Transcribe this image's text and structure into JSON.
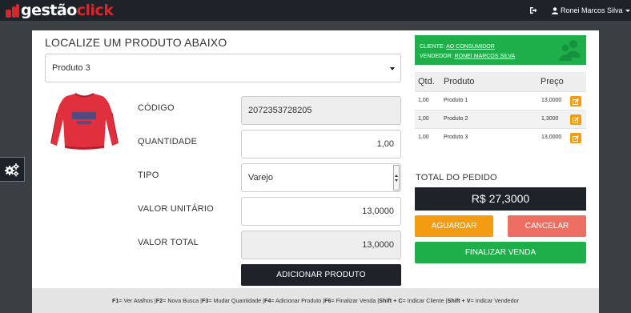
{
  "header": {
    "logo_left": "gestão",
    "logo_right": "click",
    "user_name": "Ronei Marcos Silva",
    "icons": {
      "logo": "logo-mark-icon",
      "exit": "sign-out-icon",
      "user": "user-icon",
      "menu": "caret-down-icon"
    }
  },
  "sidebar": {
    "settings_icon": "gears-icon"
  },
  "search": {
    "title": "LOCALIZE UM PRODUTO ABAIXO",
    "selected_product": "Produto 3"
  },
  "product_form": {
    "code_label": "CÓDIGO",
    "code_value": "2072353728205",
    "qty_label": "QUANTIDADE",
    "qty_value": "1,00",
    "type_label": "TIPO",
    "type_value": "Varejo",
    "unit_price_label": "VALOR UNITÁRIO",
    "unit_price_value": "13,0000",
    "total_label": "VALOR TOTAL",
    "total_value": "13,0000",
    "add_button": "ADICIONAR PRODUTO",
    "image_icon": "product-shirt-image"
  },
  "client": {
    "client_label": "CLIENTE:",
    "client_value": "AO CONSUMIDOR",
    "seller_label": "VENDEDOR:",
    "seller_value": "RONEI MARCOS SILVA",
    "icon": "users-icon"
  },
  "items_table": {
    "headers": {
      "qty": "Qtd.",
      "product": "Produto",
      "price": "Preço"
    },
    "rows": [
      {
        "qty": "1,00",
        "product": "Produto 1",
        "price": "13,0000"
      },
      {
        "qty": "1,00",
        "product": "Produto 2",
        "price": "1,3000"
      },
      {
        "qty": "1,00",
        "product": "Produto 3",
        "price": "13,0000"
      }
    ],
    "edit_icon": "edit-icon"
  },
  "order": {
    "total_title": "TOTAL DO PEDIDO",
    "total_value": "R$ 27,3000",
    "wait_button": "AGUARDAR",
    "cancel_button": "CANCELAR",
    "finish_button": "FINALIZAR VENDA"
  },
  "shortcuts": {
    "f1": "F1",
    "f1_text": " = Ver Atalhos | ",
    "f2": "F2",
    "f2_text": " = Nova Busca | ",
    "f3": "F3",
    "f3_text": " = Mudar Quantidade | ",
    "f4": "F4",
    "f4_text": " = Adicionar Produto | ",
    "f6": "F6",
    "f6_text": " = Finalizar Venda | ",
    "sc": "Shift + C",
    "sc_text": " = Indicar Cliente | ",
    "sv": "Shift + V",
    "sv_text": " = Indicar Vendedor"
  },
  "colors": {
    "dark": "#1d2328",
    "brand_red": "#d9262b",
    "green": "#1eaf4b",
    "orange": "#f39c12",
    "salmon": "#ee6e62"
  }
}
